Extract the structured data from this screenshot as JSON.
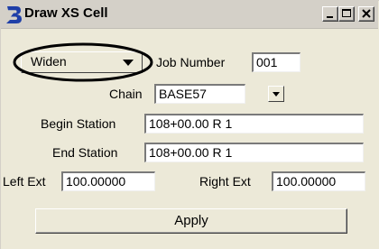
{
  "window": {
    "title": "Draw XS Cell",
    "app_icon": "bentley-b-icon",
    "controls": [
      "minimize-icon",
      "maximize-icon",
      "close-icon"
    ]
  },
  "mode": {
    "value": "Widen"
  },
  "job_number": {
    "label": "Job Number",
    "value": "001"
  },
  "chain": {
    "label": "Chain",
    "value": "BASE57"
  },
  "begin_station": {
    "label": "Begin Station",
    "value": "108+00.00 R 1"
  },
  "end_station": {
    "label": "End Station",
    "value": "108+00.00 R 1"
  },
  "left_ext": {
    "label": "Left Ext",
    "value": "100.00000"
  },
  "right_ext": {
    "label": "Right Ext",
    "value": "100.00000"
  },
  "apply_button": {
    "label": "Apply"
  },
  "colors": {
    "dialog_bg": "#ece9d8",
    "icon_blue": "#1f3fa8",
    "highlight": "#000000"
  }
}
